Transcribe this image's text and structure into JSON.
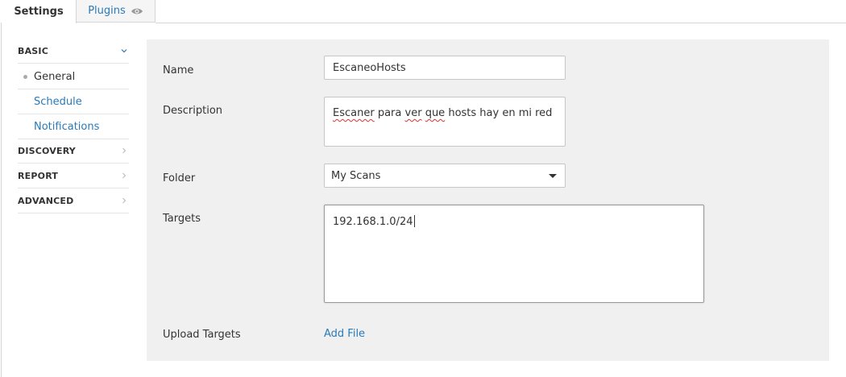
{
  "tabs": {
    "settings": "Settings",
    "plugins": "Plugins"
  },
  "sidebar": {
    "basic": "BASIC",
    "basic_items": [
      "General",
      "Schedule",
      "Notifications"
    ],
    "discovery": "DISCOVERY",
    "report": "REPORT",
    "advanced": "ADVANCED"
  },
  "form": {
    "name_label": "Name",
    "name_value": "EscaneoHosts",
    "description_label": "Description",
    "description_words": [
      "Escaner",
      "para",
      "ver",
      "que",
      "hosts hay en mi red"
    ],
    "folder_label": "Folder",
    "folder_value": "My Scans",
    "targets_label": "Targets",
    "targets_value": "192.168.1.0/24",
    "upload_label": "Upload Targets",
    "add_file": "Add File"
  },
  "colors": {
    "link": "#2a7ab8",
    "panel_bg": "#f0f0f0"
  },
  "icons": {
    "plugins_tab": "eye-icon",
    "basic_expand": "chevron-down-icon",
    "section_collapsed": "chevron-right-icon",
    "folder_dropdown": "caret-down-icon"
  }
}
